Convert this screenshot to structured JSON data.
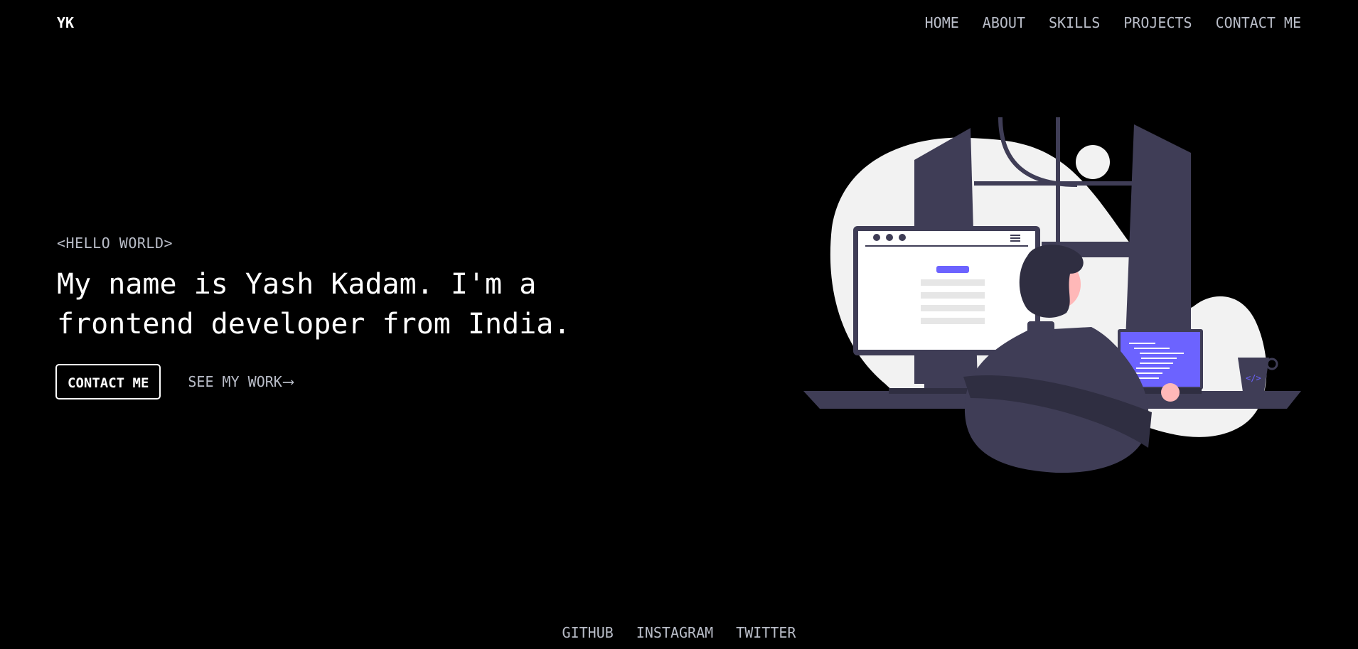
{
  "brand": {
    "logo": "YK"
  },
  "nav": {
    "items": [
      {
        "label": "HOME"
      },
      {
        "label": "ABOUT"
      },
      {
        "label": "SKILLS"
      },
      {
        "label": "PROJECTS"
      },
      {
        "label": "CONTACT ME"
      }
    ]
  },
  "hero": {
    "eyebrow": "<HELLO WORLD>",
    "headline": "My name is Yash Kadam. I'm a frontend developer from India.",
    "contact_button": "CONTACT ME",
    "see_work_link": "SEE MY WORK",
    "see_work_icon": "arrow-right-icon"
  },
  "illustration": {
    "name": "developer-at-desk-illustration",
    "accent": "#6c63ff"
  },
  "footer": {
    "links": [
      {
        "label": "GITHUB"
      },
      {
        "label": "INSTAGRAM"
      },
      {
        "label": "TWITTER"
      }
    ]
  },
  "colors": {
    "background": "#000000",
    "text": "#ffffff",
    "muted": "#b9bdc8",
    "accent": "#6c63ff"
  }
}
